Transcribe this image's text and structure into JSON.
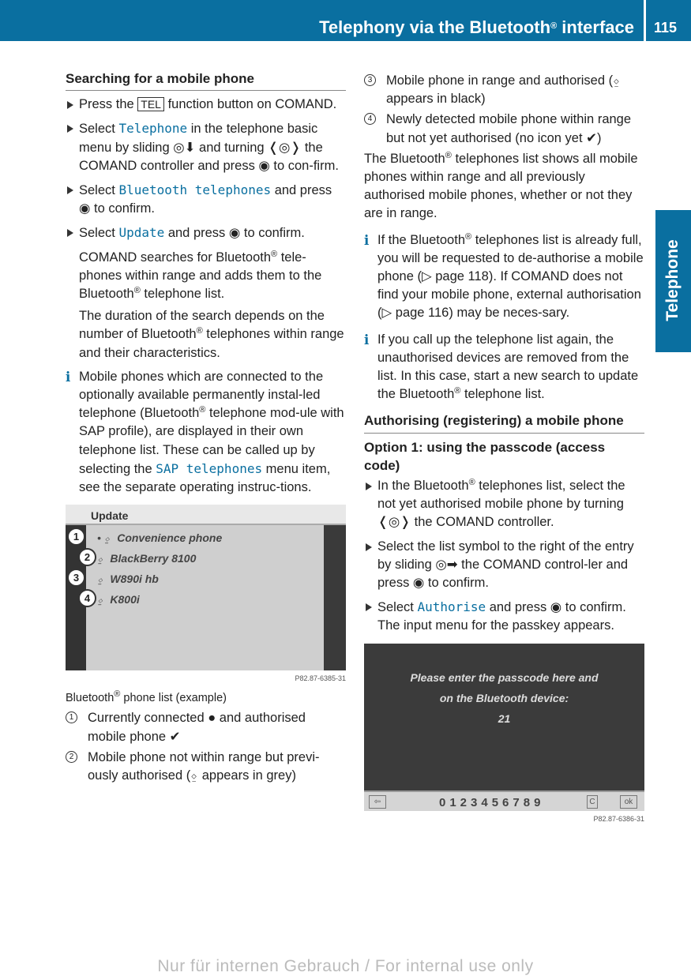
{
  "header": {
    "title": "Telephony via the Bluetooth",
    "title_reg": "®",
    "title_end": " interface",
    "page": "115"
  },
  "side_tab": "Telephone",
  "left": [
    {
      "type": "h",
      "seg": [
        "Searching for a mobile phone"
      ]
    },
    {
      "type": "step",
      "seg": [
        "Press the ",
        {
          "key": "TEL"
        },
        " function button on COMAND."
      ]
    },
    {
      "type": "step",
      "seg": [
        "Select ",
        {
          "code": "Telephone"
        },
        " in the telephone basic menu by sliding ◎⬇ and turning ❬◎❭ the COMAND controller and press ◉ to con-firm."
      ]
    },
    {
      "type": "step",
      "seg": [
        "Select ",
        {
          "code": "Bluetooth telephones"
        },
        " and press ◉ to confirm."
      ]
    },
    {
      "type": "step",
      "seg": [
        "Select ",
        {
          "code": "Update"
        },
        " and press ◉ to confirm."
      ]
    },
    {
      "type": "ind",
      "seg": [
        "COMAND searches for Bluetooth",
        {
          "sup": "®"
        },
        " tele-phones within range and adds them to the Bluetooth",
        {
          "sup": "®"
        },
        " telephone list."
      ]
    },
    {
      "type": "ind",
      "seg": [
        "The duration of the search depends on the number of Bluetooth",
        {
          "sup": "®"
        },
        " telephones within range and their characteristics."
      ]
    },
    {
      "type": "info",
      "seg": [
        "Mobile phones which are connected to the optionally available permanently instal-led telephone (Bluetooth",
        {
          "sup": "®"
        },
        " telephone mod-ule with SAP profile), are displayed in their own telephone list. These can be called up by selecting the ",
        {
          "code": "SAP telephones"
        },
        " menu item, see the separate operating instruc-tions."
      ]
    },
    {
      "type": "fig1"
    },
    {
      "type": "cap",
      "seg": [
        "Bluetooth",
        {
          "sup": "®"
        },
        " phone list (example)"
      ]
    },
    {
      "type": "num",
      "n": "1",
      "seg": [
        "Currently connected  ●  and authorised mobile phone ✔"
      ]
    },
    {
      "type": "num",
      "n": "2",
      "seg": [
        "Mobile phone not within range but previ-ously authorised (⍚ appears in grey)"
      ]
    }
  ],
  "right": [
    {
      "type": "num",
      "n": "3",
      "seg": [
        "Mobile phone in range and authorised (⍚ appears in black)"
      ]
    },
    {
      "type": "num",
      "n": "4",
      "seg": [
        "Newly detected mobile phone within range but not yet authorised (no icon yet ✔)"
      ]
    },
    {
      "type": "p",
      "seg": [
        "The Bluetooth",
        {
          "sup": "®"
        },
        " telephones list shows all mobile phones within range and all previously authorised mobile phones, whether or not they are in range."
      ]
    },
    {
      "type": "info",
      "seg": [
        "If the Bluetooth",
        {
          "sup": "®"
        },
        " telephones list is already full, you will be requested to de-authorise a mobile phone (▷ page 118). If COMAND does not find your mobile phone, external authorisation (▷ page 116) may be neces-sary."
      ]
    },
    {
      "type": "info",
      "seg": [
        "If you call up the telephone list again, the unauthorised devices are removed from the list. In this case, start a new search to update the Bluetooth",
        {
          "sup": "®"
        },
        " telephone list."
      ]
    },
    {
      "type": "h",
      "seg": [
        "Authorising (registering) a mobile phone"
      ]
    },
    {
      "type": "h3",
      "seg": [
        "Option 1: using the passcode (access code)"
      ]
    },
    {
      "type": "step",
      "seg": [
        "In the Bluetooth",
        {
          "sup": "®"
        },
        " telephones list, select the not yet authorised mobile phone by turning ❬◎❭ the COMAND controller."
      ]
    },
    {
      "type": "step",
      "seg": [
        "Select the list symbol to the right of the entry by sliding ◎➡ the COMAND control-ler and press ◉ to confirm."
      ]
    },
    {
      "type": "step",
      "seg": [
        "Select ",
        {
          "code": "Authorise"
        },
        " and press ◉ to confirm. The input menu for the passkey appears."
      ]
    },
    {
      "type": "fig2"
    }
  ],
  "fig1": {
    "title": "Update",
    "rows": [
      "Convenience phone",
      "BlackBerry 8100",
      "W890i hb",
      "K800i"
    ],
    "row_icons": [
      "•  ⍚",
      "⍚",
      "⍚",
      "⍚"
    ],
    "id": "P82.87-6385-31"
  },
  "fig2": {
    "line1": "Please enter the passcode here and",
    "line2": "on the Bluetooth device:",
    "code": "21",
    "digits": "0123456789",
    "clear": "C",
    "ok": "ok",
    "id": "P82.87-6386-31"
  },
  "watermark": "Nur für internen Gebrauch / For internal use only"
}
